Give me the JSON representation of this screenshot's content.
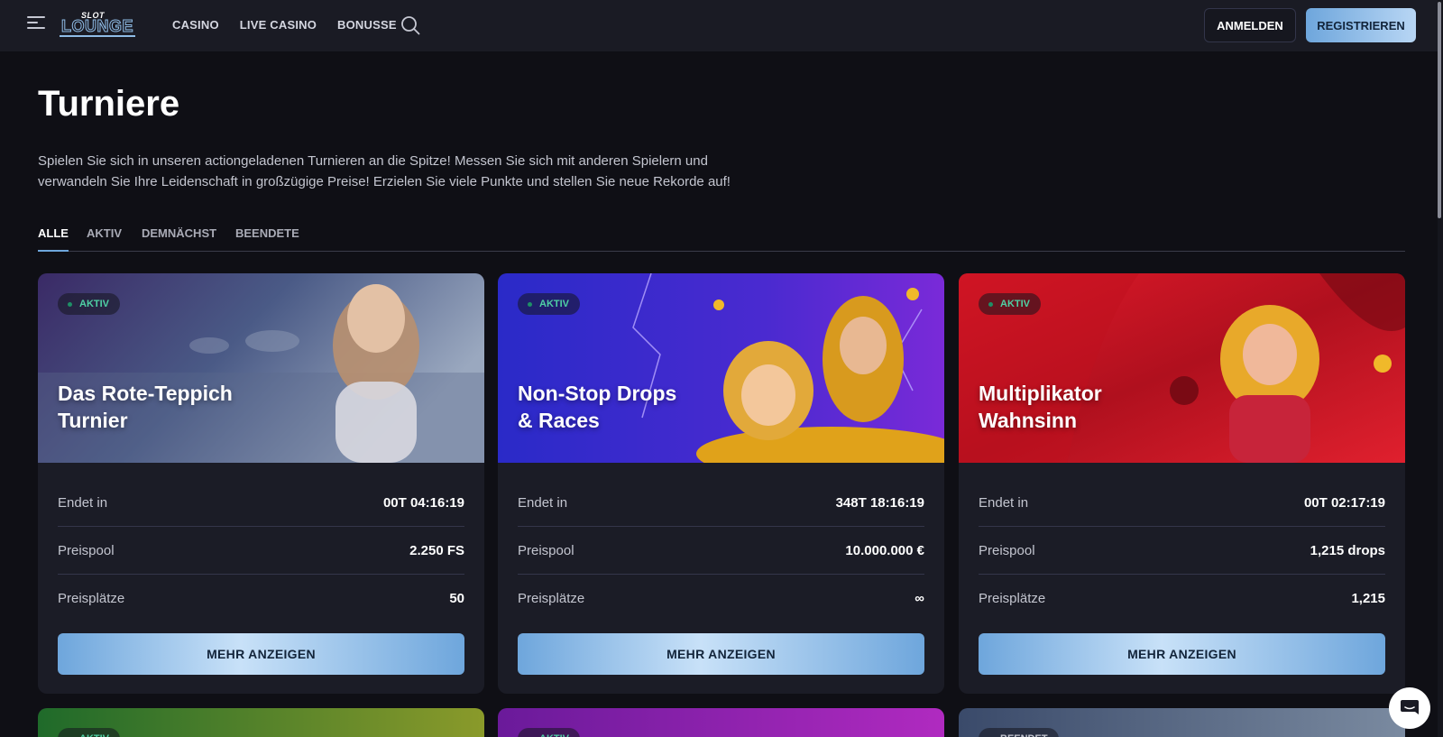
{
  "header": {
    "logo_top": "SLOT",
    "logo_main": "LOUNGE",
    "nav": [
      "CASINO",
      "LIVE CASINO",
      "BONUSSE"
    ],
    "login_label": "ANMELDEN",
    "register_label": "REGISTRIEREN"
  },
  "page": {
    "title": "Turniere",
    "description": "Spielen Sie sich in unseren actiongeladenen Turnieren an die Spitze! Messen Sie sich mit anderen Spielern und verwandeln Sie Ihre Leidenschaft in großzügige Preise! Erzielen Sie viele Punkte und stellen Sie neue Rekorde auf!"
  },
  "tabs": [
    "ALLE",
    "AKTIV",
    "DEMNÄCHST",
    "BEENDETE"
  ],
  "cards": [
    {
      "badge": "AKTIV",
      "title_line1": "Das Rote-Teppich",
      "title_line2": "Turnier",
      "rows": [
        {
          "label": "Endet in",
          "value": "00T 04:16:19"
        },
        {
          "label": "Preispool",
          "value": "2.250 FS"
        },
        {
          "label": "Preisplätze",
          "value": "50"
        }
      ],
      "button": "MEHR ANZEIGEN"
    },
    {
      "badge": "AKTIV",
      "title_line1": "Non-Stop Drops",
      "title_line2": "& Races",
      "rows": [
        {
          "label": "Endet in",
          "value": "348T 18:16:19"
        },
        {
          "label": "Preispool",
          "value": "10.000.000 €"
        },
        {
          "label": "Preisplätze",
          "value": "∞"
        }
      ],
      "button": "MEHR ANZEIGEN"
    },
    {
      "badge": "AKTIV",
      "title_line1": "Multiplikator",
      "title_line2": "Wahnsinn",
      "rows": [
        {
          "label": "Endet in",
          "value": "00T 02:17:19"
        },
        {
          "label": "Preispool",
          "value": "1,215 drops"
        },
        {
          "label": "Preisplätze",
          "value": "1,215"
        }
      ],
      "button": "MEHR ANZEIGEN"
    }
  ],
  "lower_cards": [
    {
      "badge": "AKTIV"
    },
    {
      "badge": "AKTIV"
    },
    {
      "badge": "BEENDET"
    }
  ],
  "colors": {
    "accent": "#6ea6dc",
    "active_badge": "#4fd1a5",
    "background": "#0f0f15"
  }
}
